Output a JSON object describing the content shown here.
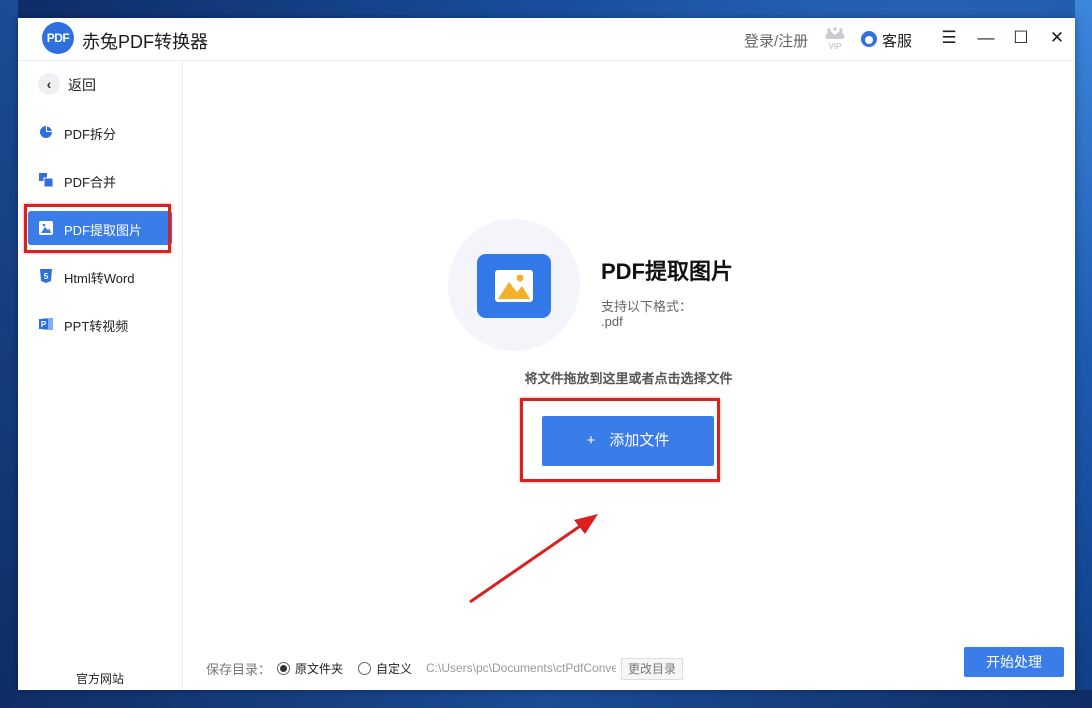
{
  "app": {
    "title": "赤兔PDF转换器",
    "logo_text": "PDF"
  },
  "header": {
    "login_label": "登录/注册",
    "vip_label": "VIP",
    "service_label": "客服"
  },
  "window_controls": {
    "menu": "☰",
    "minimize": "—",
    "maximize": "☐",
    "close": "✕"
  },
  "sidebar": {
    "back_label": "返回",
    "items": [
      {
        "label": "PDF拆分",
        "icon": "pie-chart-icon",
        "active": false
      },
      {
        "label": "PDF合并",
        "icon": "merge-squares-icon",
        "active": false
      },
      {
        "label": "PDF提取图片",
        "icon": "image-icon",
        "active": true
      },
      {
        "label": "Html转Word",
        "icon": "html5-icon",
        "active": false
      },
      {
        "label": "PPT转视频",
        "icon": "ppt-icon",
        "active": false
      }
    ],
    "website_label": "官方网站"
  },
  "main": {
    "feature_title": "PDF提取图片",
    "formats_label": "支持以下格式：",
    "formats_value": ".pdf",
    "drop_hint": "将文件拖放到这里或者点击选择文件",
    "add_button": {
      "plus": "+",
      "label": "添加文件"
    }
  },
  "footer": {
    "save_label": "保存目录：",
    "option_original": "原文件夹",
    "option_custom": "自定义",
    "selected_option": "原文件夹",
    "path_value": "C:\\Users\\pc\\Documents\\ctPdfConverter",
    "change_button": "更改目录",
    "start_button": "开始处理"
  },
  "colors": {
    "accent": "#3a7ce8",
    "highlight_box": "#d9211f",
    "arrow": "#d9211f"
  }
}
